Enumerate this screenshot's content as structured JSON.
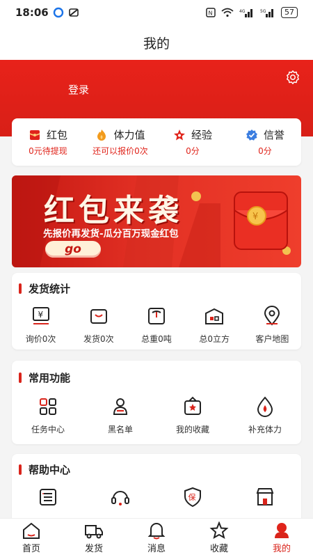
{
  "status_bar": {
    "time": "18:06",
    "battery": "57"
  },
  "page_title": "我的",
  "header": {
    "login_label": "登录"
  },
  "stats": [
    {
      "name": "红包",
      "sub": "0元待提现",
      "icon": "red-packet-icon"
    },
    {
      "name": "体力值",
      "sub": "还可以报价0次",
      "icon": "flame-icon"
    },
    {
      "name": "经验",
      "sub": "0分",
      "icon": "star-icon"
    },
    {
      "name": "信誉",
      "sub": "0分",
      "icon": "credit-badge-icon"
    }
  ],
  "banner": {
    "title": "红包来袭",
    "subtitle": "先报价再发货-瓜分百万现金红包",
    "button": "go"
  },
  "shipping_stats": {
    "title": "发货统计",
    "items": [
      {
        "label": "询价0次",
        "icon": "inquiry-icon"
      },
      {
        "label": "发货0次",
        "icon": "ship-box-icon"
      },
      {
        "label": "总重0吨",
        "icon": "weight-icon"
      },
      {
        "label": "总0立方",
        "icon": "volume-icon"
      },
      {
        "label": "客户地图",
        "icon": "map-pin-icon"
      }
    ]
  },
  "common_functions": {
    "title": "常用功能",
    "items": [
      {
        "label": "任务中心",
        "icon": "task-grid-icon"
      },
      {
        "label": "黑名单",
        "icon": "blacklist-icon"
      },
      {
        "label": "我的收藏",
        "icon": "favorite-box-icon"
      },
      {
        "label": "补充体力",
        "icon": "energy-drop-icon"
      }
    ]
  },
  "help_center": {
    "title": "帮助中心",
    "items": [
      {
        "label": "",
        "icon": "complaint-list-icon"
      },
      {
        "label": "",
        "icon": "headset-icon"
      },
      {
        "label": "",
        "icon": "insurance-icon"
      },
      {
        "label": "",
        "icon": "store-icon"
      }
    ]
  },
  "tab_bar": [
    {
      "label": "首页",
      "icon": "home-icon"
    },
    {
      "label": "发货",
      "icon": "truck-icon"
    },
    {
      "label": "消息",
      "icon": "bell-icon"
    },
    {
      "label": "收藏",
      "icon": "star-tab-icon"
    },
    {
      "label": "我的",
      "icon": "profile-icon"
    }
  ],
  "colors": {
    "brand_red": "#d9241b",
    "background": "#f4f4f4"
  }
}
